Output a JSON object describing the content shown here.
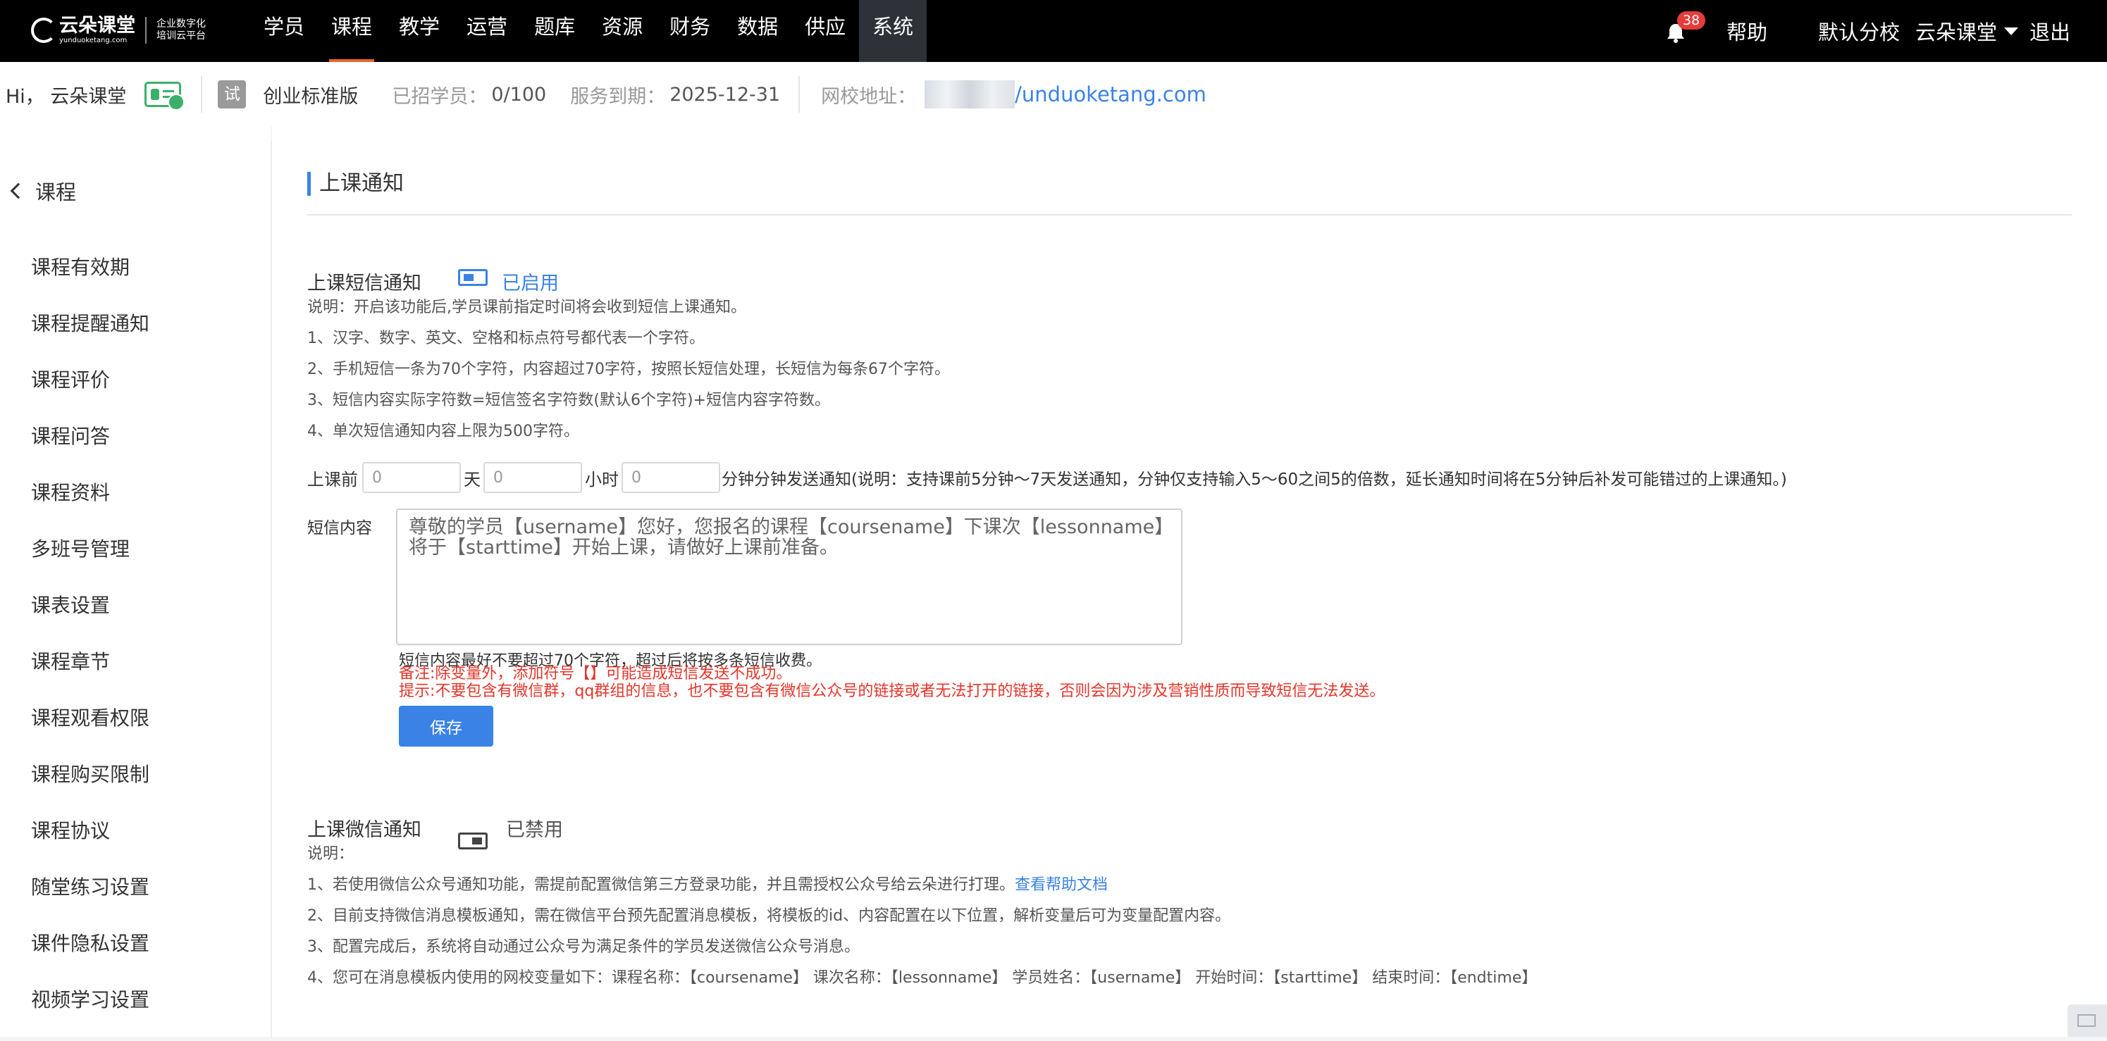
{
  "header": {
    "logo_text": "云朵课堂",
    "logo_domain": "yunduoketang.com",
    "logo_slogan_1": "企业数字化",
    "logo_slogan_2": "培训云平台",
    "nav": [
      "学员",
      "课程",
      "教学",
      "运营",
      "题库",
      "资源",
      "财务",
      "数据",
      "供应",
      "系统"
    ],
    "notification_count": "38",
    "help": "帮助",
    "branch": "默认分校",
    "account": "云朵课堂",
    "logout": "退出"
  },
  "info_bar": {
    "greeting": "Hi， 云朵课堂",
    "trial_badge": "试",
    "edition": "创业标准版",
    "enrolled_label": "已招学员：",
    "enrolled_value": "0/100",
    "expiry_label": "服务到期：",
    "expiry_value": "2025-12-31",
    "school_url_label": "网校地址：",
    "school_url_suffix": "/unduoketang.com"
  },
  "sidebar": {
    "back_label": "课程",
    "items": [
      "课程有效期",
      "课程提醒通知",
      "课程评价",
      "课程问答",
      "课程资料",
      "多班号管理",
      "课表设置",
      "课程章节",
      "课程观看权限",
      "课程购买限制",
      "课程协议",
      "随堂练习设置",
      "课件隐私设置",
      "视频学习设置"
    ]
  },
  "main": {
    "page_title": "上课通知",
    "sms": {
      "title": "上课短信通知",
      "status": "已启用",
      "notes": [
        "说明：开启该功能后,学员课前指定时间将会收到短信上课通知。",
        "1、汉字、数字、英文、空格和标点符号都代表一个字符。",
        "2、手机短信一条为70个字符，内容超过70字符，按照长短信处理，长短信为每条67个字符。",
        "3、短信内容实际字符数=短信签名字符数(默认6个字符)+短信内容字符数。",
        "4、单次短信通知内容上限为500字符。"
      ],
      "before_label": "上课前",
      "day_label": "天",
      "hour_label": "小时",
      "day_value": "0",
      "hour_value": "0",
      "minute_value": "0",
      "schedule_note": "分钟分钟发送通知(说明：支持课前5分钟～7天发送通知，分钟仅支持输入5～60之间5的倍数，延长通知时间将在5分钟后补发可能错过的上课通知。)",
      "content_label": "短信内容",
      "content": "尊敬的学员【username】您好，您报名的课程【coursename】下课次【lessonname】将于【starttime】开始上课，请做好上课前准备。",
      "hint_length": "短信内容最好不要超过70个字符，超过后将按多条短信收费。",
      "hint_symbol": "备注:除变量外，添加符号【】可能造成短信发送不成功。",
      "hint_content": "提示:不要包含有微信群，qq群组的信息，也不要包含有微信公众号的链接或者无法打开的链接，否则会因为涉及营销性质而导致短信无法发送。",
      "save_button": "保存"
    },
    "wechat": {
      "title": "上课微信通知",
      "status": "已禁用",
      "note_label": "说明：",
      "note_1": "1、若使用微信公众号通知功能，需提前配置微信第三方登录功能，并且需授权公众号给云朵进行打理。",
      "help_link": "查看帮助文档",
      "note_2": "2、目前支持微信消息模板通知，需在微信平台预先配置消息模板，将模板的id、内容配置在以下位置，解析变量后可为变量配置内容。",
      "note_3": "3、配置完成后，系统将自动通过公众号为满足条件的学员发送微信公众号消息。",
      "note_4": "4、您可在消息模板内使用的网校变量如下：课程名称：【coursename】 课次名称：【lessonname】 学员姓名：【username】 开始时间：【starttime】 结束时间：【endtime】"
    }
  },
  "colors": {
    "accent": "#3a82e6",
    "warning": "#e4352a",
    "active_tab_line": "#e8632a",
    "topbar_bg": "#000000"
  }
}
